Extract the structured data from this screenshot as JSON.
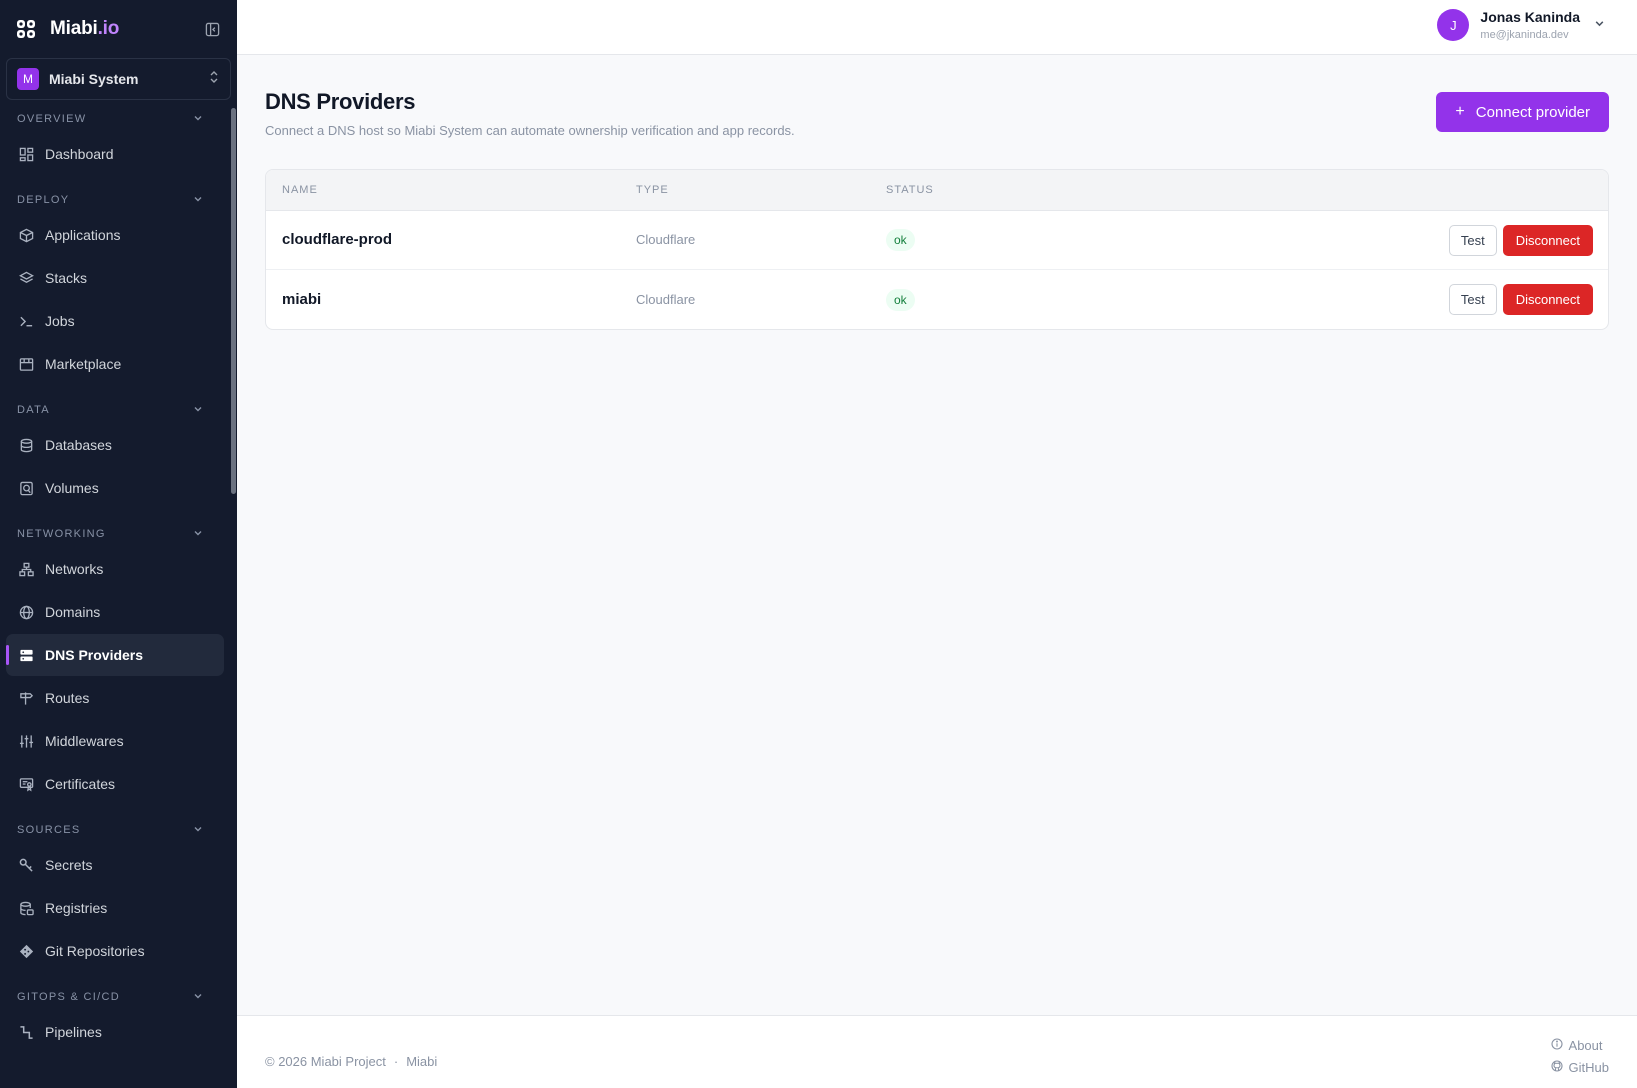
{
  "brand": {
    "name": "Miabi",
    "suffix": ".io"
  },
  "workspace": {
    "initial": "M",
    "name": "Miabi System"
  },
  "sidebar": {
    "sections": [
      {
        "title": "OVERVIEW",
        "items": [
          {
            "label": "Dashboard",
            "icon": "dashboard-icon"
          }
        ]
      },
      {
        "title": "DEPLOY",
        "items": [
          {
            "label": "Applications",
            "icon": "box-icon"
          },
          {
            "label": "Stacks",
            "icon": "layers-icon"
          },
          {
            "label": "Jobs",
            "icon": "terminal-icon"
          },
          {
            "label": "Marketplace",
            "icon": "store-icon"
          }
        ]
      },
      {
        "title": "DATA",
        "items": [
          {
            "label": "Databases",
            "icon": "database-icon"
          },
          {
            "label": "Volumes",
            "icon": "volume-icon"
          }
        ]
      },
      {
        "title": "NETWORKING",
        "items": [
          {
            "label": "Networks",
            "icon": "network-icon"
          },
          {
            "label": "Domains",
            "icon": "globe-icon"
          },
          {
            "label": "DNS Providers",
            "icon": "server-icon",
            "active": true
          },
          {
            "label": "Routes",
            "icon": "signpost-icon"
          },
          {
            "label": "Middlewares",
            "icon": "sliders-icon"
          },
          {
            "label": "Certificates",
            "icon": "certificate-icon"
          }
        ]
      },
      {
        "title": "SOURCES",
        "items": [
          {
            "label": "Secrets",
            "icon": "key-icon"
          },
          {
            "label": "Registries",
            "icon": "registry-icon"
          },
          {
            "label": "Git Repositories",
            "icon": "git-icon"
          }
        ]
      },
      {
        "title": "GITOPS & CI/CD",
        "items": [
          {
            "label": "Pipelines",
            "icon": "pipeline-icon"
          }
        ]
      }
    ]
  },
  "user": {
    "initial": "J",
    "name": "Jonas Kaninda",
    "email": "me@jkaninda.dev"
  },
  "page": {
    "title": "DNS Providers",
    "subtitle": "Connect a DNS host so Miabi System can automate ownership verification and app records.",
    "connect_label": "Connect provider"
  },
  "table": {
    "columns": [
      "NAME",
      "TYPE",
      "STATUS"
    ],
    "rows": [
      {
        "name": "cloudflare-prod",
        "type": "Cloudflare",
        "status": "ok",
        "test_label": "Test",
        "disconnect_label": "Disconnect"
      },
      {
        "name": "miabi",
        "type": "Cloudflare",
        "status": "ok",
        "test_label": "Test",
        "disconnect_label": "Disconnect"
      }
    ]
  },
  "footer": {
    "copyright": "© 2026 Miabi Project",
    "separator": "·",
    "project": "Miabi",
    "about": "About",
    "github": "GitHub"
  },
  "colors": {
    "accent": "#9333ea",
    "sidebar_bg": "#141b2d",
    "danger": "#dc2626",
    "success_text": "#15803d"
  }
}
